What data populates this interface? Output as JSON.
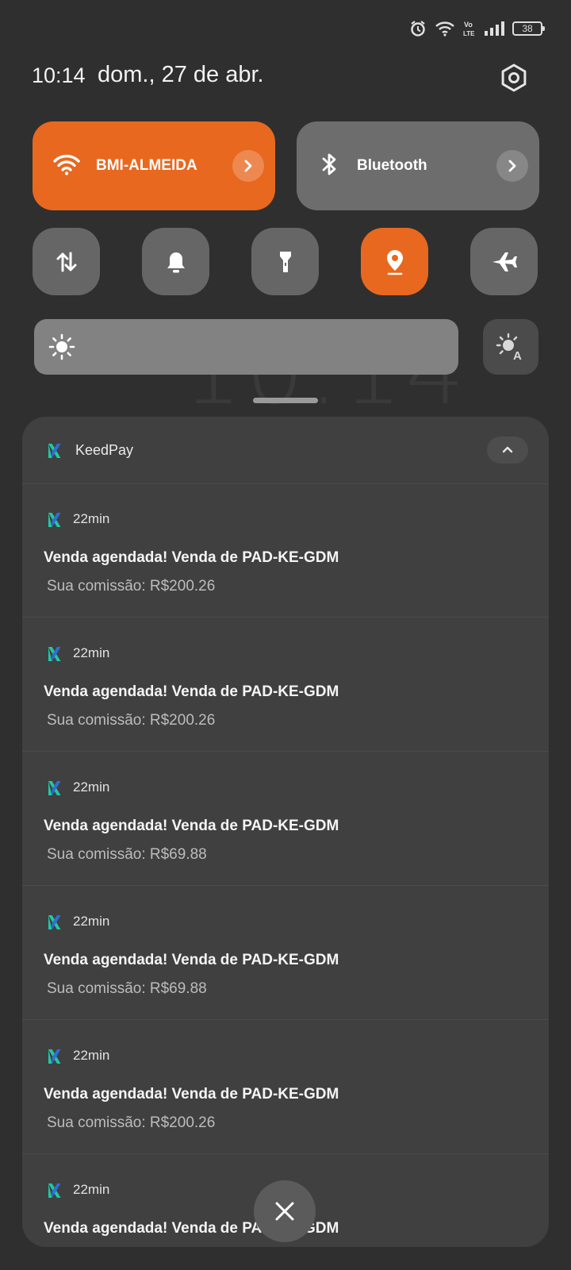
{
  "wallpaper": {
    "clock": "10:14"
  },
  "status_bar": {
    "icons": [
      "alarm-icon",
      "wifi-icon",
      "volte-icon",
      "signal-icon"
    ],
    "volte_label": "Vo LTE",
    "battery": "38"
  },
  "header": {
    "time": "10:14",
    "date": "dom., 27 de abr."
  },
  "quick_settings": {
    "wifi": {
      "label": "BMI-ALMEIDA",
      "active": true
    },
    "bluetooth": {
      "label": "Bluetooth",
      "active": false
    },
    "toggles": [
      {
        "icon": "mobile-data-icon",
        "active": false
      },
      {
        "icon": "bell-icon",
        "active": false
      },
      {
        "icon": "flashlight-icon",
        "active": false
      },
      {
        "icon": "location-icon",
        "active": true
      },
      {
        "icon": "airplane-icon",
        "active": false
      }
    ],
    "brightness_level": 0.0,
    "auto_brightness_label": "A"
  },
  "notifications": {
    "app_name": "KeedPay",
    "items": [
      {
        "time": "22min",
        "title": "Venda agendada! Venda de PAD-KE-GDM",
        "body": "Sua comissão: R$200.26"
      },
      {
        "time": "22min",
        "title": "Venda agendada! Venda de PAD-KE-GDM",
        "body": "Sua comissão: R$200.26"
      },
      {
        "time": "22min",
        "title": "Venda agendada! Venda de PAD-KE-GDM",
        "body": "Sua comissão: R$69.88"
      },
      {
        "time": "22min",
        "title": "Venda agendada! Venda de PAD-KE-GDM",
        "body": "Sua comissão: R$69.88"
      },
      {
        "time": "22min",
        "title": "Venda agendada! Venda de PAD-KE-GDM",
        "body": "Sua comissão: R$200.26"
      },
      {
        "time": "22min",
        "title": "Venda agendada! Venda de PAD-KE-GDM",
        "body": ""
      }
    ]
  },
  "colors": {
    "accent": "#e8681f",
    "logo_teal": "#1fc8a8",
    "logo_blue": "#2e6fd8"
  }
}
